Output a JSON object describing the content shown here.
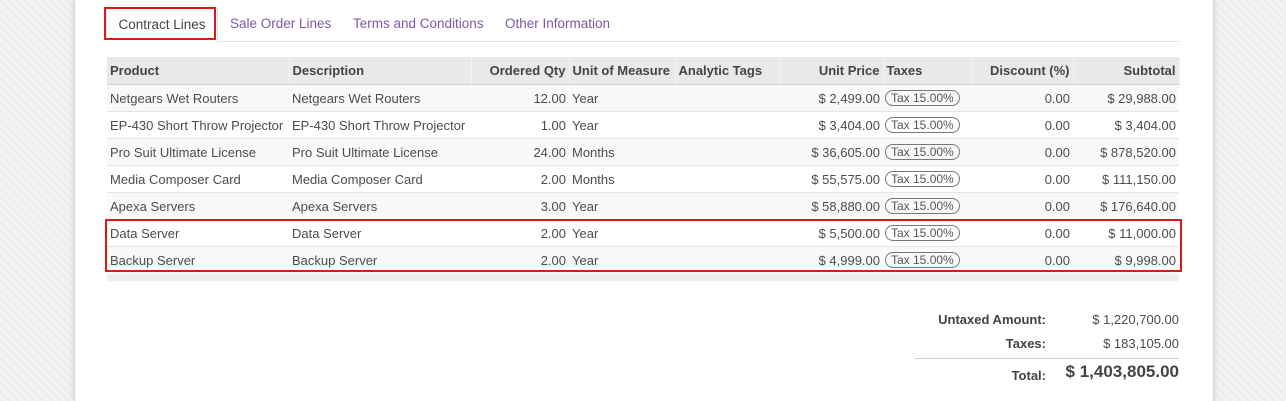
{
  "tabs": [
    {
      "label": "Contract Lines",
      "active": true
    },
    {
      "label": "Sale Order Lines",
      "active": false
    },
    {
      "label": "Terms and Conditions",
      "active": false
    },
    {
      "label": "Other Information",
      "active": false
    }
  ],
  "table": {
    "headers": {
      "product": "Product",
      "description": "Description",
      "ordered_qty": "Ordered Qty",
      "unit_of_measure": "Unit of Measure",
      "analytic_tags": "Analytic Tags",
      "unit_price": "Unit Price",
      "taxes": "Taxes",
      "discount": "Discount (%)",
      "subtotal": "Subtotal"
    },
    "rows": [
      {
        "product": "Netgears Wet Routers",
        "description": "Netgears Wet Routers",
        "qty": "12.00",
        "uom": "Year",
        "tags": "",
        "price": "$ 2,499.00",
        "tax": "Tax 15.00%",
        "discount": "0.00",
        "subtotal": "$ 29,988.00"
      },
      {
        "product": "EP-430 Short Throw Projector",
        "description": "EP-430 Short Throw Projector",
        "qty": "1.00",
        "uom": "Year",
        "tags": "",
        "price": "$ 3,404.00",
        "tax": "Tax 15.00%",
        "discount": "0.00",
        "subtotal": "$ 3,404.00"
      },
      {
        "product": "Pro Suit Ultimate License",
        "description": "Pro Suit Ultimate License",
        "qty": "24.00",
        "uom": "Months",
        "tags": "",
        "price": "$ 36,605.00",
        "tax": "Tax 15.00%",
        "discount": "0.00",
        "subtotal": "$ 878,520.00"
      },
      {
        "product": "Media Composer Card",
        "description": "Media Composer Card",
        "qty": "2.00",
        "uom": "Months",
        "tags": "",
        "price": "$ 55,575.00",
        "tax": "Tax 15.00%",
        "discount": "0.00",
        "subtotal": "$ 111,150.00"
      },
      {
        "product": "Apexa Servers",
        "description": "Apexa Servers",
        "qty": "3.00",
        "uom": "Year",
        "tags": "",
        "price": "$ 58,880.00",
        "tax": "Tax 15.00%",
        "discount": "0.00",
        "subtotal": "$ 176,640.00"
      },
      {
        "product": "Data Server",
        "description": "Data Server",
        "qty": "2.00",
        "uom": "Year",
        "tags": "",
        "price": "$ 5,500.00",
        "tax": "Tax 15.00%",
        "discount": "0.00",
        "subtotal": "$ 11,000.00"
      },
      {
        "product": "Backup Server",
        "description": "Backup Server",
        "qty": "2.00",
        "uom": "Year",
        "tags": "",
        "price": "$ 4,999.00",
        "tax": "Tax 15.00%",
        "discount": "0.00",
        "subtotal": "$ 9,998.00"
      }
    ]
  },
  "totals": {
    "untaxed_label": "Untaxed Amount:",
    "untaxed_value": "$ 1,220,700.00",
    "taxes_label": "Taxes:",
    "taxes_value": "$ 183,105.00",
    "total_label": "Total:",
    "total_value": "$ 1,403,805.00"
  },
  "colors": {
    "link": "#7c5aa6",
    "highlight": "#d91a1a",
    "header_bg": "#e8e9ea"
  }
}
